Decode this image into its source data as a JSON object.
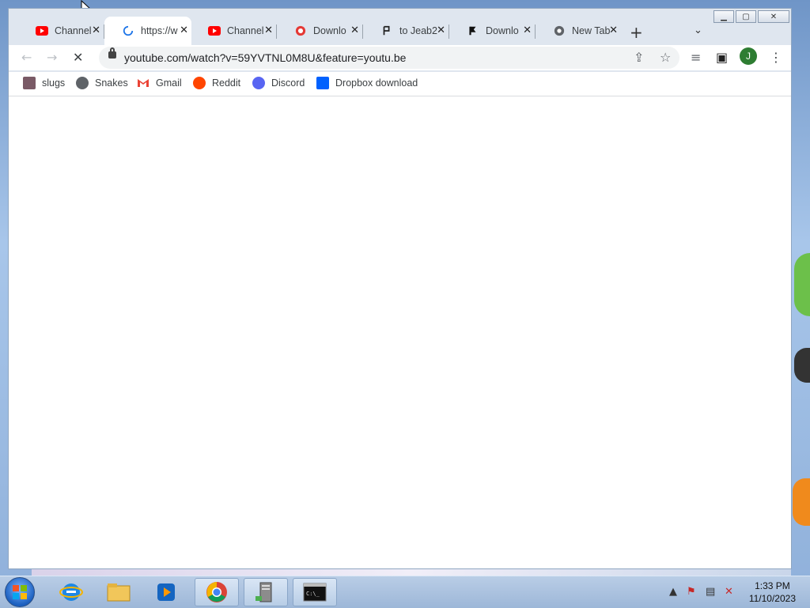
{
  "browser": {
    "tabs": [
      {
        "title": "Channel",
        "favicon": "youtube-icon",
        "active": false
      },
      {
        "title": "https://w",
        "favicon": "loading-spinner-icon",
        "active": true
      },
      {
        "title": "Channel",
        "favicon": "youtube-icon",
        "active": false
      },
      {
        "title": "Downlo",
        "favicon": "download-icon",
        "active": false
      },
      {
        "title": "to Jeab2",
        "favicon": "p-flag-icon",
        "active": false
      },
      {
        "title": "Downlo",
        "favicon": "f-flag-icon",
        "active": false
      },
      {
        "title": "New Tab",
        "favicon": "chrome-icon",
        "active": false
      }
    ],
    "tab_close_glyph": "✕",
    "new_tab_glyph": "+",
    "tab_list_glyph": "⌄",
    "url": "youtube.com/watch?v=59YVTNL0M8U&feature=youtu.be",
    "avatar_letter": "J",
    "bookmarks": [
      {
        "label": "slugs",
        "icon": "slug-icon"
      },
      {
        "label": "Snakes",
        "icon": "globe-icon"
      },
      {
        "label": "Gmail",
        "icon": "gmail-icon"
      },
      {
        "label": "Reddit",
        "icon": "reddit-icon"
      },
      {
        "label": "Discord",
        "icon": "discord-icon"
      },
      {
        "label": "Dropbox download",
        "icon": "dropbox-icon"
      }
    ]
  },
  "window_controls": {
    "minimize": "▁",
    "maximize": "▢",
    "close": "✕"
  },
  "taskbar": {
    "clock_time": "1:33 PM",
    "clock_date": "11/10/2023",
    "items": [
      "internet-explorer-icon",
      "file-explorer-icon",
      "media-player-icon",
      "chrome-icon",
      "server-icon",
      "command-prompt-icon"
    ]
  },
  "colors": {
    "accent": "#1a73e8",
    "youtube_red": "#ff0000",
    "avatar_green": "#2e7d32"
  }
}
